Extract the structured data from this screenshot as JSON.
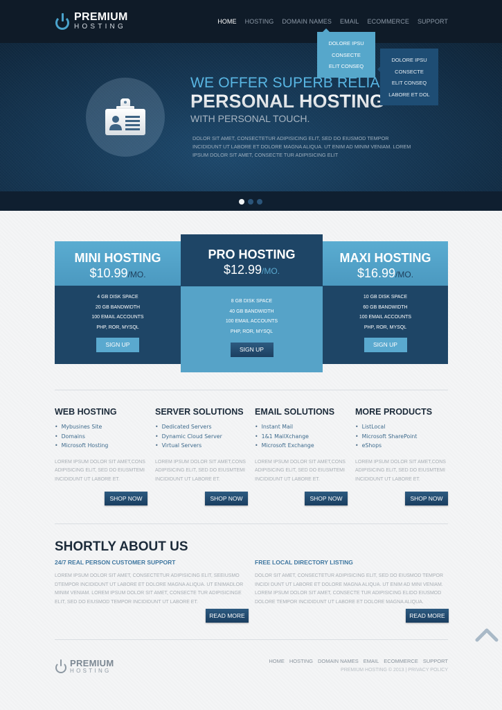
{
  "brand": {
    "line1": "PREMIUM",
    "line2": "HOSTING"
  },
  "nav": {
    "items": [
      {
        "label": "HOME",
        "active": true
      },
      {
        "label": "HOSTING",
        "active": false
      },
      {
        "label": "DOMAIN NAMES",
        "active": false
      },
      {
        "label": "EMAIL",
        "active": false
      },
      {
        "label": "ECOMMERCE",
        "active": false
      },
      {
        "label": "SUPPORT",
        "active": false
      }
    ],
    "dropdown": [
      "DOLORE IPSU",
      "CONSECTE",
      "ELIT CONSEQ"
    ],
    "submenu": [
      "DOLORE IPSU",
      "CONSECTE",
      "ELIT CONSEQ",
      "LABORE ET DOL"
    ]
  },
  "hero": {
    "icon": "id-badge-icon",
    "line1": "WE OFFER SUPERB RELIABLE",
    "line2": "PERSONAL HOSTING",
    "line3": "WITH PERSONAL TOUCH.",
    "description": "DOLOR SIT AMET, CONSECTETUR ADIPISICING ELIT, SED DO EIUSMOD TEMPOR INCIDIDUNT UT LABORE ET DOLORE MAGNA ALIQUA. UT ENIM AD MINIM VENIAM. LOREM IPSUM DOLOR SIT AMET, CONSECTE TUR ADIPISICING ELIT",
    "slides": {
      "count": 3,
      "active": 1
    }
  },
  "plans": [
    {
      "name": "MINI HOSTING",
      "price": "$10.99",
      "period": "/MO.",
      "features": [
        "4 GB DISK SPACE",
        "20 GB BANDWIDTH",
        "100 EMAIL ACCOUNTS",
        "PHP, ROR, MYSQL"
      ],
      "button": "SIGN UP"
    },
    {
      "name": "PRO HOSTING",
      "price": "$12.99",
      "period": "/MO.",
      "features": [
        "8 GB DISK SPACE",
        "40 GB BANDWIDTH",
        "100 EMAIL ACCOUNTS",
        "PHP, ROR, MYSQL"
      ],
      "button": "SIGN UP"
    },
    {
      "name": "MAXI HOSTING",
      "price": "$16.99",
      "period": "/MO.",
      "features": [
        "10 GB DISK SPACE",
        "60 GB BANDWIDTH",
        "100 EMAIL ACCOUNTS",
        "PHP, ROR, MYSQL"
      ],
      "button": "SIGN UP"
    }
  ],
  "products": [
    {
      "title": "WEB HOSTING",
      "items": [
        "Mybusines Site",
        "Domains",
        "Microsoft Hosting"
      ],
      "text": "LOREM IPSUM DOLOR SIT AMET,CONS ADIPISICING ELIT, SED DO EIUSMTEMI INCIDIDUNT UT LABORE ET.",
      "button": "SHOP NOW"
    },
    {
      "title": "SERVER SOLUTIONS",
      "items": [
        "Dedicated Servers",
        "Dynamic Cloud Server",
        "Virtual Servers"
      ],
      "text": "LOREM IPSUM DOLOR SIT AMET,CONS ADIPISICING ELIT, SED DO EIUSMTEMI INCIDIDUNT UT LABORE ET.",
      "button": "SHOP NOW"
    },
    {
      "title": "EMAIL SOLUTIONS",
      "items": [
        "Instant Mail",
        "1&1 MailXchange",
        "Microsoft Exchange"
      ],
      "text": "LOREM IPSUM DOLOR SIT AMET,CONS ADIPISICING ELIT, SED DO EIUSMTEMI INCIDIDUNT UT LABORE ET.",
      "button": "SHOP NOW"
    },
    {
      "title": "MORE PRODUCTS",
      "items": [
        "ListLocal",
        "Microsoft SharePoint",
        "eShops"
      ],
      "text": "LOREM IPSUM DOLOR SIT AMET,CONS ADIPISICING ELIT, SED DO EIUSMTEMI INCIDIDUNT UT LABORE ET.",
      "button": "SHOP NOW"
    }
  ],
  "about": {
    "title": "SHORTLY ABOUT US",
    "columns": [
      {
        "heading": "24/7 REAL PERSON CUSTOMER SUPPORT",
        "text": "LOREM IPSUM DOLOR SIT AMET, CONSECTETUR ADIPISICING ELIT, SEEIUSMO DTEMPOR INCIDIDUNT UT LABORE ET DOLORE MAGNA ALIQUA. UT ENIMADLOR MINIM VENIAM. LOREM IPSUM DOLOR SIT AMET, CONSECTE TUR ADIPISICINGE ELIT, SED DO EIUSMOD TEMPOR INCIDIDUNT UT LABORE ET.",
        "button": "READ MORE"
      },
      {
        "heading": "FREE LOCAL DIRECTORY LISTING",
        "text": "DOLOR SIT AMET, CONSECTETUR ADIPISICING ELIT, SED DO EIUSMOD TEMPOR INCIDI DUNT UT LABORE ET DOLORE MAGNA ALIQUA. UT ENIM AD MINI VENIAM. LOREM IPSUM DOLOR SIT AMET, CONSECTE TUR ADIPISICING ELIDO EIUSMOD DOLORE TEMPOR INCIDIDUNT UT LABORE ET DOLORE MAGNA ALIQUA.",
        "button": "READ MORE"
      }
    ]
  },
  "footer": {
    "nav": [
      "HOME",
      "HOSTING",
      "DOMAIN NAMES",
      "EMAIL",
      "ECOMMERCE",
      "SUPPORT"
    ],
    "copyright": "PREMIUM HOSTING © 2013",
    "separator": "|",
    "privacy": "PRIVACY POLICY"
  },
  "colors": {
    "accent": "#56a7cb",
    "dark": "#1e4566",
    "header": "#0f1b28"
  }
}
